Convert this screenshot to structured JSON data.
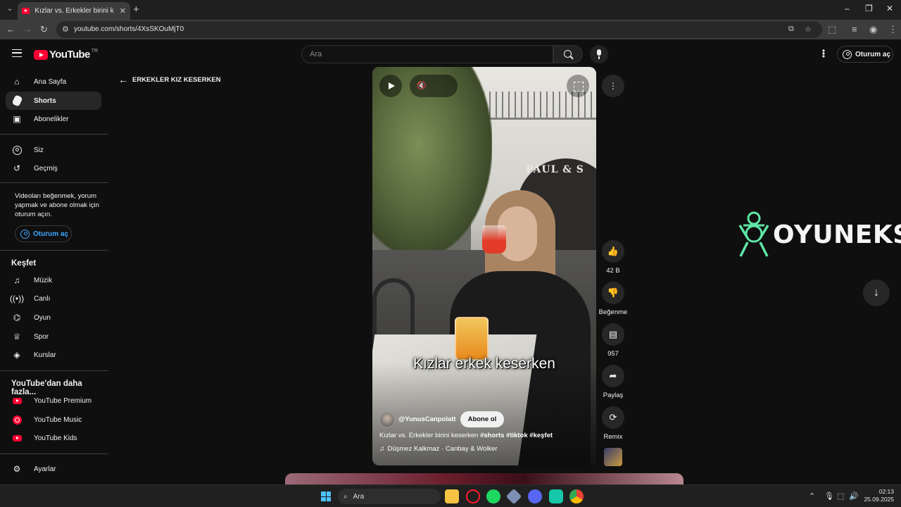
{
  "browser": {
    "tab_title": "Kızlar vs. Erkekler birini keserken...",
    "url": "youtube.com/shorts/4XsSKOuMjT0",
    "window_controls": [
      "–",
      "❐",
      "✕"
    ]
  },
  "header": {
    "logo_text": "YouTube",
    "country_code": "TR",
    "search_placeholder": "Ara",
    "signin_label": "Oturum aç"
  },
  "sidebar": {
    "main_items": [
      {
        "label": "Ana Sayfa",
        "icon": "home-icon"
      },
      {
        "label": "Shorts",
        "icon": "shorts-icon"
      },
      {
        "label": "Abonelikler",
        "icon": "subscriptions-icon"
      }
    ],
    "you_items": [
      {
        "label": "Siz",
        "icon": "user-icon"
      },
      {
        "label": "Geçmiş",
        "icon": "history-icon"
      }
    ],
    "signin_note": "Videoları beğenmek, yorum yapmak ve abone olmak için oturum açın.",
    "signin_label": "Oturum aç",
    "explore_title": "Keşfet",
    "explore_items": [
      {
        "label": "Müzik",
        "icon": "music-icon"
      },
      {
        "label": "Canlı",
        "icon": "live-icon"
      },
      {
        "label": "Oyun",
        "icon": "gaming-icon"
      },
      {
        "label": "Spor",
        "icon": "trophy-icon"
      },
      {
        "label": "Kurslar",
        "icon": "courses-icon"
      }
    ],
    "more_title": "YouTube'dan daha fazla...",
    "more_items": [
      {
        "label": "YouTube Premium",
        "icon": "youtube-premium-icon"
      },
      {
        "label": "YouTube Music",
        "icon": "youtube-music-icon"
      },
      {
        "label": "YouTube Kids",
        "icon": "youtube-kids-icon"
      }
    ],
    "settings_label": "Ayarlar"
  },
  "shorts": {
    "back_title": "ERKEKLER KIZ KESERKEN",
    "caption": "Kızlar erkek keserken",
    "scene_sign": "PAUL & S",
    "channel_handle": "@YunusCanpolatt",
    "subscribe_label": "Abone ol",
    "description_text": "Kızlar vs. Erkekler birini keserken ",
    "hashtags": "#shorts #tiktok #keşfet",
    "music": "Düşmez Kalkmaz · Canbay & Wolker"
  },
  "actions": {
    "likes": "42 B",
    "dislike_label": "Beğenme",
    "comments": "957",
    "share_label": "Paylaş",
    "remix_label": "Remix"
  },
  "overlay": {
    "watermark_text": "OYUNEKS"
  },
  "taskbar": {
    "search_label": "Ara",
    "time": "02:13",
    "date": "25.09.2025"
  },
  "colors": {
    "brand_red": "#ff0033",
    "link_blue": "#3ea6ff",
    "watermark_green": "#5fe6a6"
  }
}
